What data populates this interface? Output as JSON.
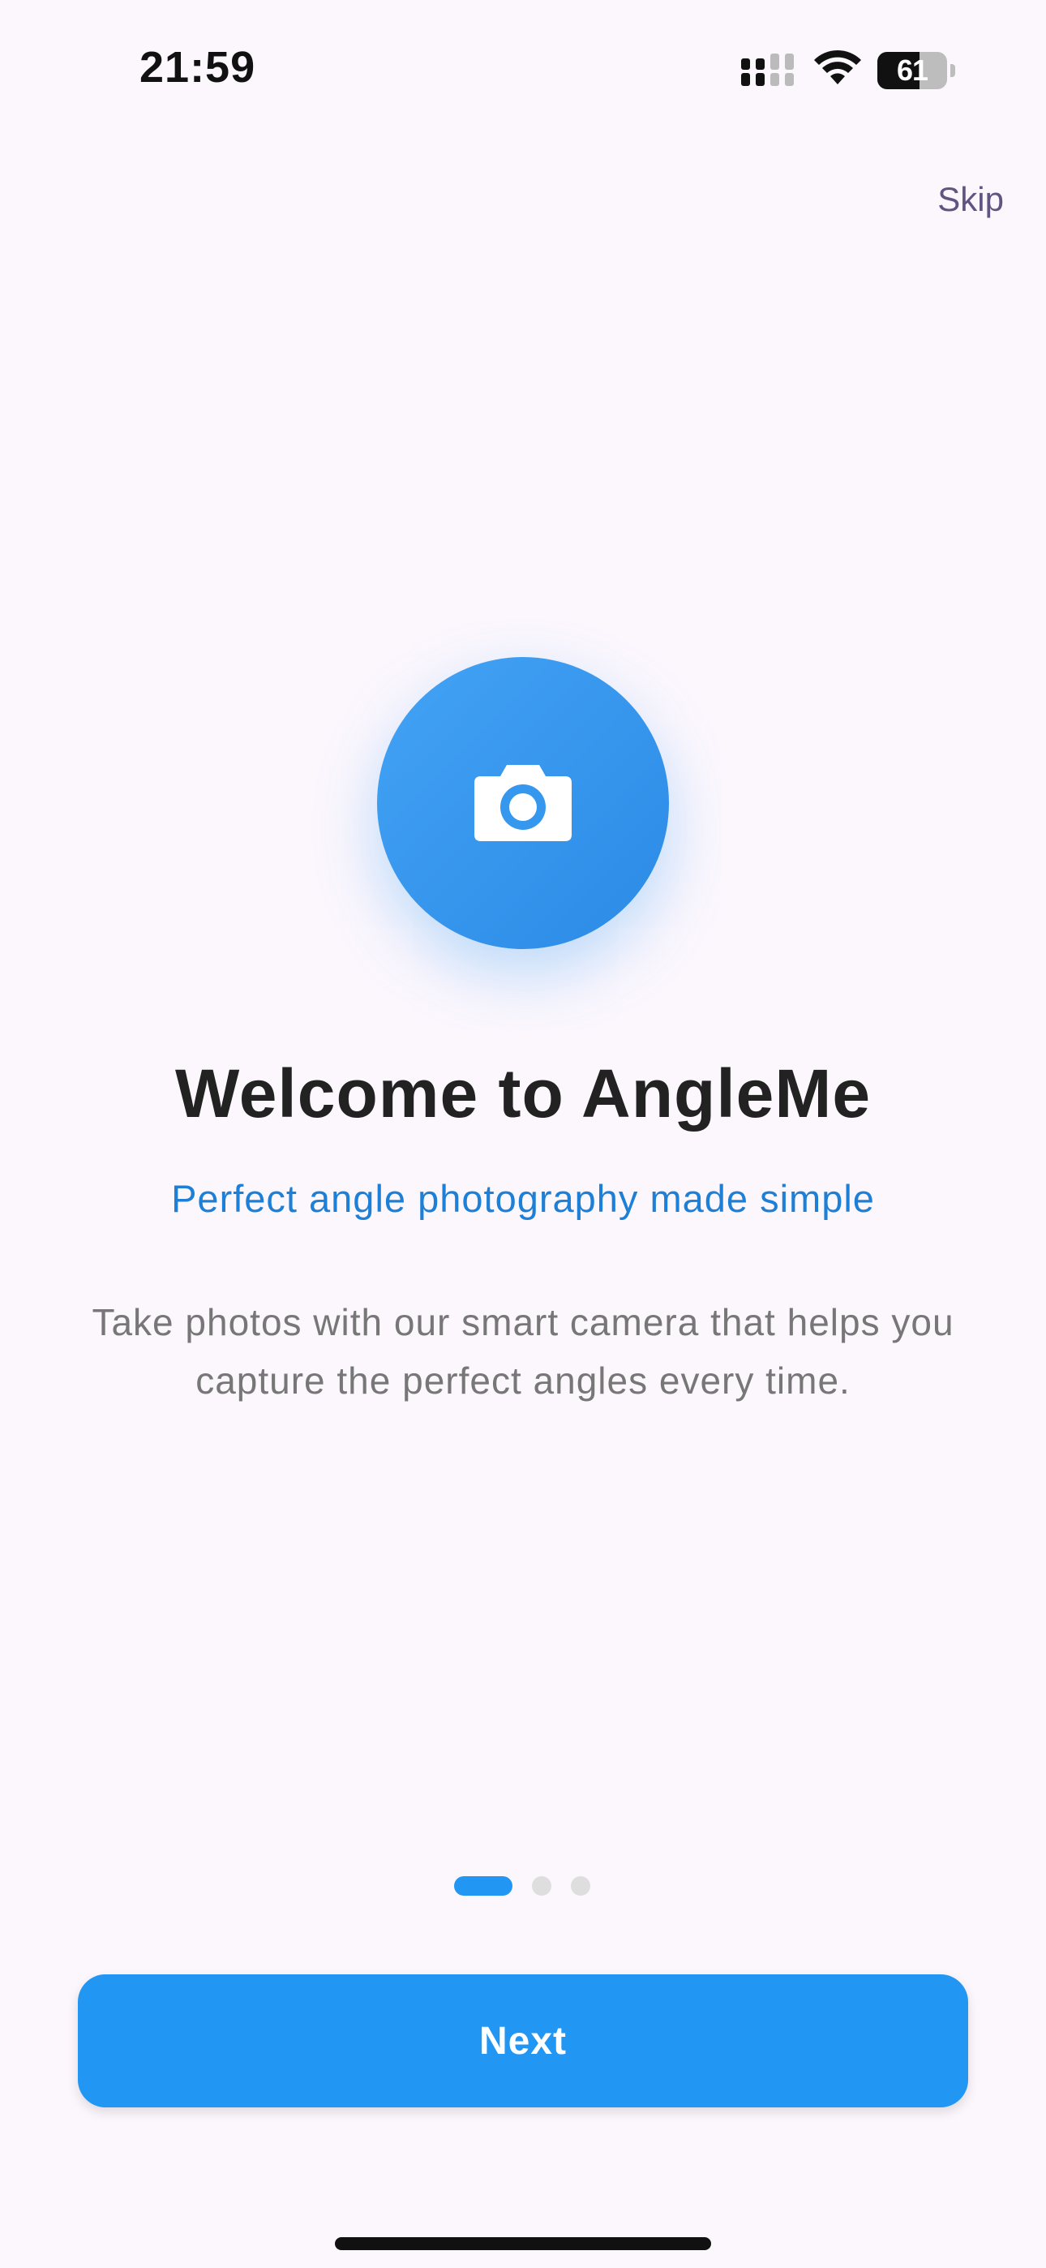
{
  "status_bar": {
    "time": "21:59",
    "battery_level": "61",
    "icons": [
      "signal-icon",
      "wifi-icon",
      "battery-icon"
    ]
  },
  "onboarding": {
    "skip_label": "Skip",
    "hero_icon": "camera-icon",
    "title": "Welcome to AngleMe",
    "subtitle": "Perfect angle photography made simple",
    "description": "Take photos with our smart camera that helps you capture the perfect angles every time.",
    "page_indicator": {
      "current_page": 1,
      "total_pages": 3
    },
    "next_label": "Next"
  },
  "colors": {
    "accent": "#2196f3",
    "subtitle": "#1e7fd6",
    "background": "#fcf7fd",
    "skip": "#5f5581"
  }
}
